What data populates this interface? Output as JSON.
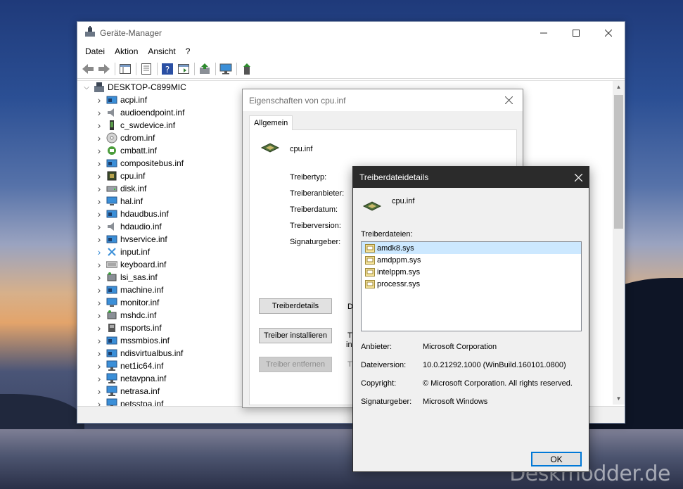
{
  "main_window": {
    "title": "Geräte-Manager",
    "menu": [
      "Datei",
      "Aktion",
      "Ansicht",
      "?"
    ],
    "tree": {
      "root": "DESKTOP-C899MIC",
      "items": [
        {
          "label": "acpi.inf",
          "icon": "device-icon"
        },
        {
          "label": "audioendpoint.inf",
          "icon": "speaker-icon"
        },
        {
          "label": "c_swdevice.inf",
          "icon": "phone-icon"
        },
        {
          "label": "cdrom.inf",
          "icon": "cdrom-icon"
        },
        {
          "label": "cmbatt.inf",
          "icon": "battery-icon"
        },
        {
          "label": "compositebus.inf",
          "icon": "device-icon"
        },
        {
          "label": "cpu.inf",
          "icon": "chip-icon"
        },
        {
          "label": "disk.inf",
          "icon": "disk-icon"
        },
        {
          "label": "hal.inf",
          "icon": "monitor-icon"
        },
        {
          "label": "hdaudbus.inf",
          "icon": "device-icon"
        },
        {
          "label": "hdaudio.inf",
          "icon": "speaker-icon"
        },
        {
          "label": "hvservice.inf",
          "icon": "device-icon"
        },
        {
          "label": "input.inf",
          "icon": "input-icon"
        },
        {
          "label": "keyboard.inf",
          "icon": "keyboard-icon"
        },
        {
          "label": "lsi_sas.inf",
          "icon": "storage-icon"
        },
        {
          "label": "machine.inf",
          "icon": "device-icon"
        },
        {
          "label": "monitor.inf",
          "icon": "monitor-icon"
        },
        {
          "label": "mshdc.inf",
          "icon": "storage-icon"
        },
        {
          "label": "msports.inf",
          "icon": "port-icon"
        },
        {
          "label": "mssmbios.inf",
          "icon": "device-icon"
        },
        {
          "label": "ndisvirtualbus.inf",
          "icon": "device-icon"
        },
        {
          "label": "net1ic64.inf",
          "icon": "network-icon"
        },
        {
          "label": "netavpna.inf",
          "icon": "network-icon"
        },
        {
          "label": "netrasa.inf",
          "icon": "network-icon"
        },
        {
          "label": "netsstpa.inf",
          "icon": "network-icon"
        }
      ]
    }
  },
  "properties_dialog": {
    "title": "Eigenschaften von cpu.inf",
    "tab": "Allgemein",
    "device_name": "cpu.inf",
    "fields": [
      "Treibertyp:",
      "Treiberanbieter:",
      "Treiberdatum:",
      "Treiberversion:",
      "Signaturgeber:"
    ],
    "buttons": {
      "details": "Treiberdetails",
      "install": "Treiber installieren",
      "remove": "Treiber entfernen"
    },
    "button_desc": {
      "details": "De",
      "install_1": "Tr",
      "install_2": "ins",
      "remove": "Tr"
    }
  },
  "details_dialog": {
    "title": "Treiberdateidetails",
    "device_name": "cpu.inf",
    "files_label": "Treiberdateien:",
    "files": [
      "amdk8.sys",
      "amdppm.sys",
      "intelppm.sys",
      "processr.sys"
    ],
    "selected_index": 0,
    "info": {
      "provider_label": "Anbieter:",
      "provider": "Microsoft Corporation",
      "version_label": "Dateiversion:",
      "version": "10.0.21292.1000 (WinBuild.160101.0800)",
      "copyright_label": "Copyright:",
      "copyright": "© Microsoft Corporation. All rights reserved.",
      "signer_label": "Signaturgeber:",
      "signer": "Microsoft Windows"
    },
    "ok": "OK"
  },
  "watermark": "Deskmodder.de"
}
